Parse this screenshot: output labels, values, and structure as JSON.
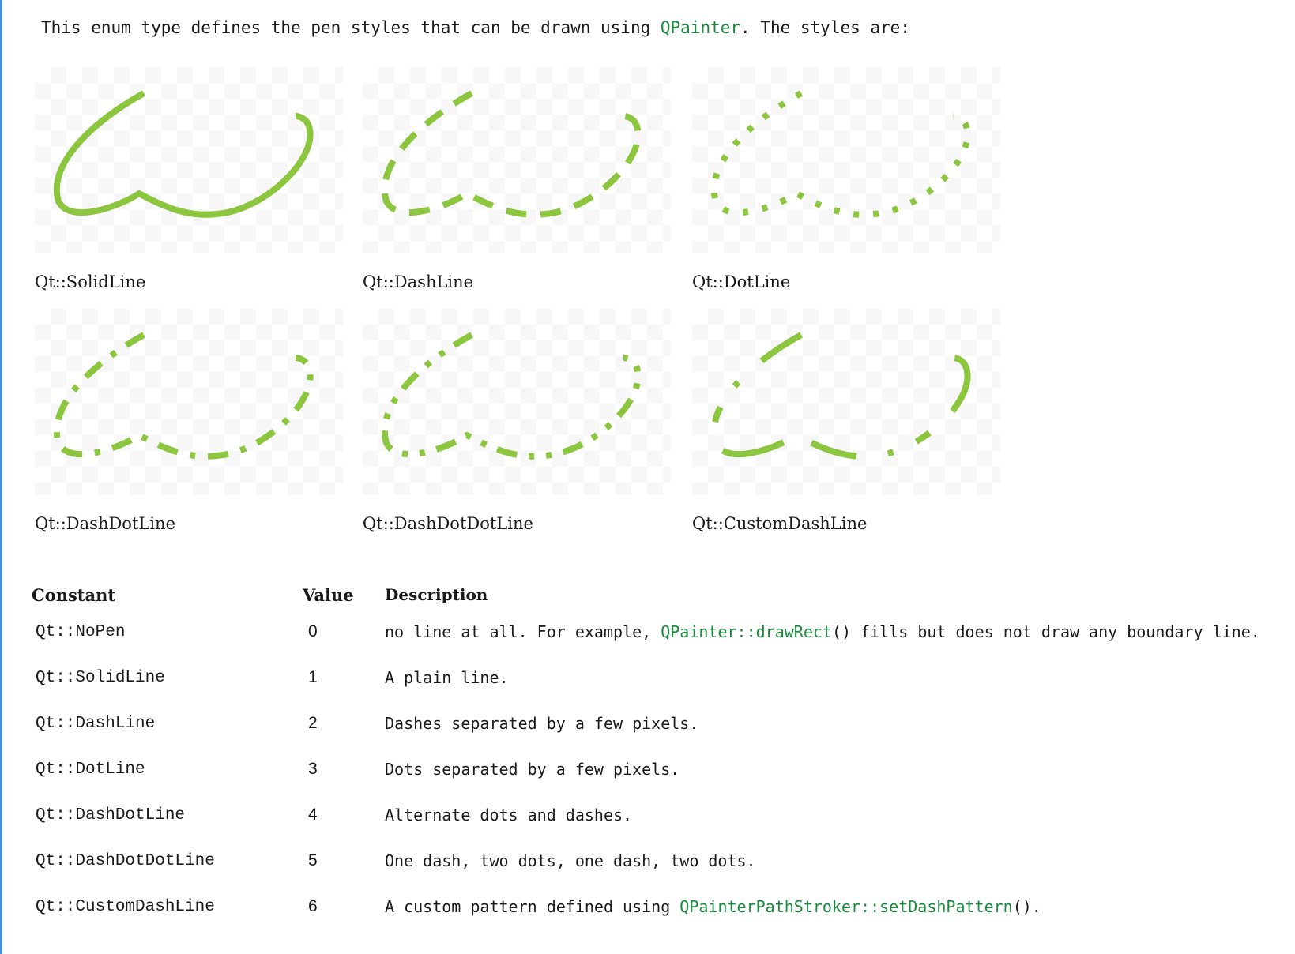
{
  "intro": {
    "before": "This enum type defines the pen styles that can be drawn using ",
    "link": "QPainter",
    "after": ". The styles are:"
  },
  "pen_styles": [
    {
      "name": "Qt::SolidLine",
      "style": "solid"
    },
    {
      "name": "Qt::DashLine",
      "style": "dash"
    },
    {
      "name": "Qt::DotLine",
      "style": "dot"
    },
    {
      "name": "Qt::DashDotLine",
      "style": "dashdot"
    },
    {
      "name": "Qt::DashDotDotLine",
      "style": "dashdotdot"
    },
    {
      "name": "Qt::CustomDashLine",
      "style": "custom"
    }
  ],
  "colors": {
    "stroke": "#8cc63f",
    "link": "#1a8a3d",
    "border": "#4a8fd6"
  },
  "table": {
    "headers": {
      "constant": "Constant",
      "value": "Value",
      "description": "Description"
    },
    "rows": [
      {
        "constant": "Qt::NoPen",
        "value": "0",
        "desc_before": "no line at all. For example, ",
        "desc_link": "QPainter::drawRect",
        "desc_after": "() fills but does not draw any boundary line."
      },
      {
        "constant": "Qt::SolidLine",
        "value": "1",
        "desc_before": "A plain line.",
        "desc_link": "",
        "desc_after": ""
      },
      {
        "constant": "Qt::DashLine",
        "value": "2",
        "desc_before": "Dashes separated by a few pixels.",
        "desc_link": "",
        "desc_after": ""
      },
      {
        "constant": "Qt::DotLine",
        "value": "3",
        "desc_before": "Dots separated by a few pixels.",
        "desc_link": "",
        "desc_after": ""
      },
      {
        "constant": "Qt::DashDotLine",
        "value": "4",
        "desc_before": "Alternate dots and dashes.",
        "desc_link": "",
        "desc_after": ""
      },
      {
        "constant": "Qt::DashDotDotLine",
        "value": "5",
        "desc_before": "One dash, two dots, one dash, two dots.",
        "desc_link": "",
        "desc_after": ""
      },
      {
        "constant": "Qt::CustomDashLine",
        "value": "6",
        "desc_before": "A custom pattern defined using ",
        "desc_link": "QPainterPathStroker::setDashPattern",
        "desc_after": "()."
      }
    ]
  }
}
